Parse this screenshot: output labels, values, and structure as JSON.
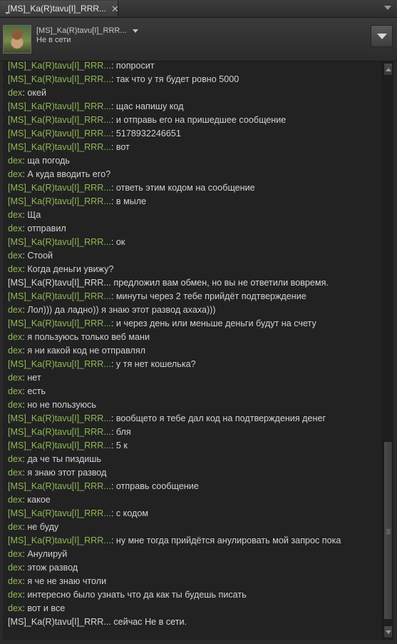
{
  "window": {
    "tab_title": "[MS]_Ka(R)tavu[I]_RRR...",
    "tab_close": "✕"
  },
  "header": {
    "friend_name": "[MS]_Ka(R)tavu[I]_RRR...",
    "friend_status": "Не в сети"
  },
  "colors": {
    "friend_name": "#8fb957",
    "text": "#d2d2d2",
    "background": "#222222"
  },
  "messages": [
    {
      "sender": "[MS]_Ka(R)tavu[I]_RRR...",
      "sep": ": ",
      "text": "попросит",
      "type": "friend"
    },
    {
      "sender": "[MS]_Ka(R)tavu[I]_RRR...",
      "sep": ": ",
      "text": "так что у тя будет ровно 5000",
      "type": "friend"
    },
    {
      "sender": "dex",
      "sep": ": ",
      "text": "окей",
      "type": "me"
    },
    {
      "sender": "[MS]_Ka(R)tavu[I]_RRR...",
      "sep": ": ",
      "text": "щас напишу код",
      "type": "friend"
    },
    {
      "sender": "[MS]_Ka(R)tavu[I]_RRR...",
      "sep": ": ",
      "text": "и отправь его на пришедшее сообщение",
      "type": "friend"
    },
    {
      "sender": "[MS]_Ka(R)tavu[I]_RRR...",
      "sep": ": ",
      "text": "5178932246651",
      "type": "friend"
    },
    {
      "sender": "[MS]_Ka(R)tavu[I]_RRR...",
      "sep": ": ",
      "text": "вот",
      "type": "friend"
    },
    {
      "sender": "dex",
      "sep": ": ",
      "text": "ща погодь",
      "type": "me"
    },
    {
      "sender": "dex",
      "sep": ": ",
      "text": "А куда вводить его?",
      "type": "me"
    },
    {
      "sender": "[MS]_Ka(R)tavu[I]_RRR...",
      "sep": ": ",
      "text": "ответь этим кодом на сообщение",
      "type": "friend"
    },
    {
      "sender": "[MS]_Ka(R)tavu[I]_RRR...",
      "sep": ": ",
      "text": "в мыле",
      "type": "friend"
    },
    {
      "sender": "dex",
      "sep": ": ",
      "text": "Ща",
      "type": "me"
    },
    {
      "sender": "dex",
      "sep": ": ",
      "text": "отправил",
      "type": "me"
    },
    {
      "sender": "[MS]_Ka(R)tavu[I]_RRR...",
      "sep": ": ",
      "text": "ок",
      "type": "friend"
    },
    {
      "sender": "dex",
      "sep": ": ",
      "text": "Стоой",
      "type": "me"
    },
    {
      "sender": "dex",
      "sep": ": ",
      "text": "Когда деньги увижу?",
      "type": "me"
    },
    {
      "sender": "[MS]_Ka(R)tavu[I]_RRR...",
      "sep": " ",
      "text": "предложил вам обмен, но вы не ответили вовремя.",
      "type": "system"
    },
    {
      "sender": "[MS]_Ka(R)tavu[I]_RRR...",
      "sep": ": ",
      "text": "минуты через 2 тебе прийдёт подтверждение",
      "type": "friend"
    },
    {
      "sender": "dex",
      "sep": ": ",
      "text": "Лол))) да ладно)) я знаю этот развод ахаха)))",
      "type": "me"
    },
    {
      "sender": "[MS]_Ka(R)tavu[I]_RRR...",
      "sep": ": ",
      "text": "и через день или меньше деньги будут на счету",
      "type": "friend"
    },
    {
      "sender": "dex",
      "sep": ": ",
      "text": "я пользуюсь только веб мани",
      "type": "me"
    },
    {
      "sender": "dex",
      "sep": ": ",
      "text": "я ни какой код не отправлял",
      "type": "me"
    },
    {
      "sender": "[MS]_Ka(R)tavu[I]_RRR...",
      "sep": ": ",
      "text": "у тя нет кошелька?",
      "type": "friend"
    },
    {
      "sender": "dex",
      "sep": ": ",
      "text": "нет",
      "type": "me"
    },
    {
      "sender": "dex",
      "sep": ": ",
      "text": "есть",
      "type": "me"
    },
    {
      "sender": "dex",
      "sep": ": ",
      "text": "но не пользуюсь",
      "type": "me"
    },
    {
      "sender": "[MS]_Ka(R)tavu[I]_RRR...",
      "sep": ": ",
      "text": "вообщето я тебе дал код на подтверждения денег",
      "type": "friend"
    },
    {
      "sender": "[MS]_Ka(R)tavu[I]_RRR...",
      "sep": ": ",
      "text": "бля",
      "type": "friend"
    },
    {
      "sender": "[MS]_Ka(R)tavu[I]_RRR...",
      "sep": ": ",
      "text": "5 к",
      "type": "friend"
    },
    {
      "sender": "dex",
      "sep": ": ",
      "text": "да че ты пиздишь",
      "type": "me"
    },
    {
      "sender": "dex",
      "sep": ": ",
      "text": "я знаю этот развод",
      "type": "me"
    },
    {
      "sender": "[MS]_Ka(R)tavu[I]_RRR...",
      "sep": ": ",
      "text": "отправь сообщение",
      "type": "friend"
    },
    {
      "sender": "dex",
      "sep": ": ",
      "text": "какое",
      "type": "me"
    },
    {
      "sender": "[MS]_Ka(R)tavu[I]_RRR...",
      "sep": ": ",
      "text": "с кодом",
      "type": "friend"
    },
    {
      "sender": "dex",
      "sep": ": ",
      "text": "не буду",
      "type": "me"
    },
    {
      "sender": "[MS]_Ka(R)tavu[I]_RRR...",
      "sep": ": ",
      "text": "ну мне тогда прийдётся анулировать мой запрос пока",
      "type": "friend"
    },
    {
      "sender": "dex",
      "sep": ": ",
      "text": "Анулируй",
      "type": "me"
    },
    {
      "sender": "dex",
      "sep": ": ",
      "text": "этож развод",
      "type": "me"
    },
    {
      "sender": "dex",
      "sep": ": ",
      "text": "я че не знаю чтоли",
      "type": "me"
    },
    {
      "sender": "dex",
      "sep": ": ",
      "text": "интересно было узнать что да как ты будешь писать",
      "type": "me"
    },
    {
      "sender": "dex",
      "sep": ": ",
      "text": "вот и все",
      "type": "me"
    },
    {
      "sender": "[MS]_Ka(R)tavu[I]_RRR...",
      "sep": " ",
      "text": "сейчас Не в сети.",
      "type": "system"
    }
  ]
}
